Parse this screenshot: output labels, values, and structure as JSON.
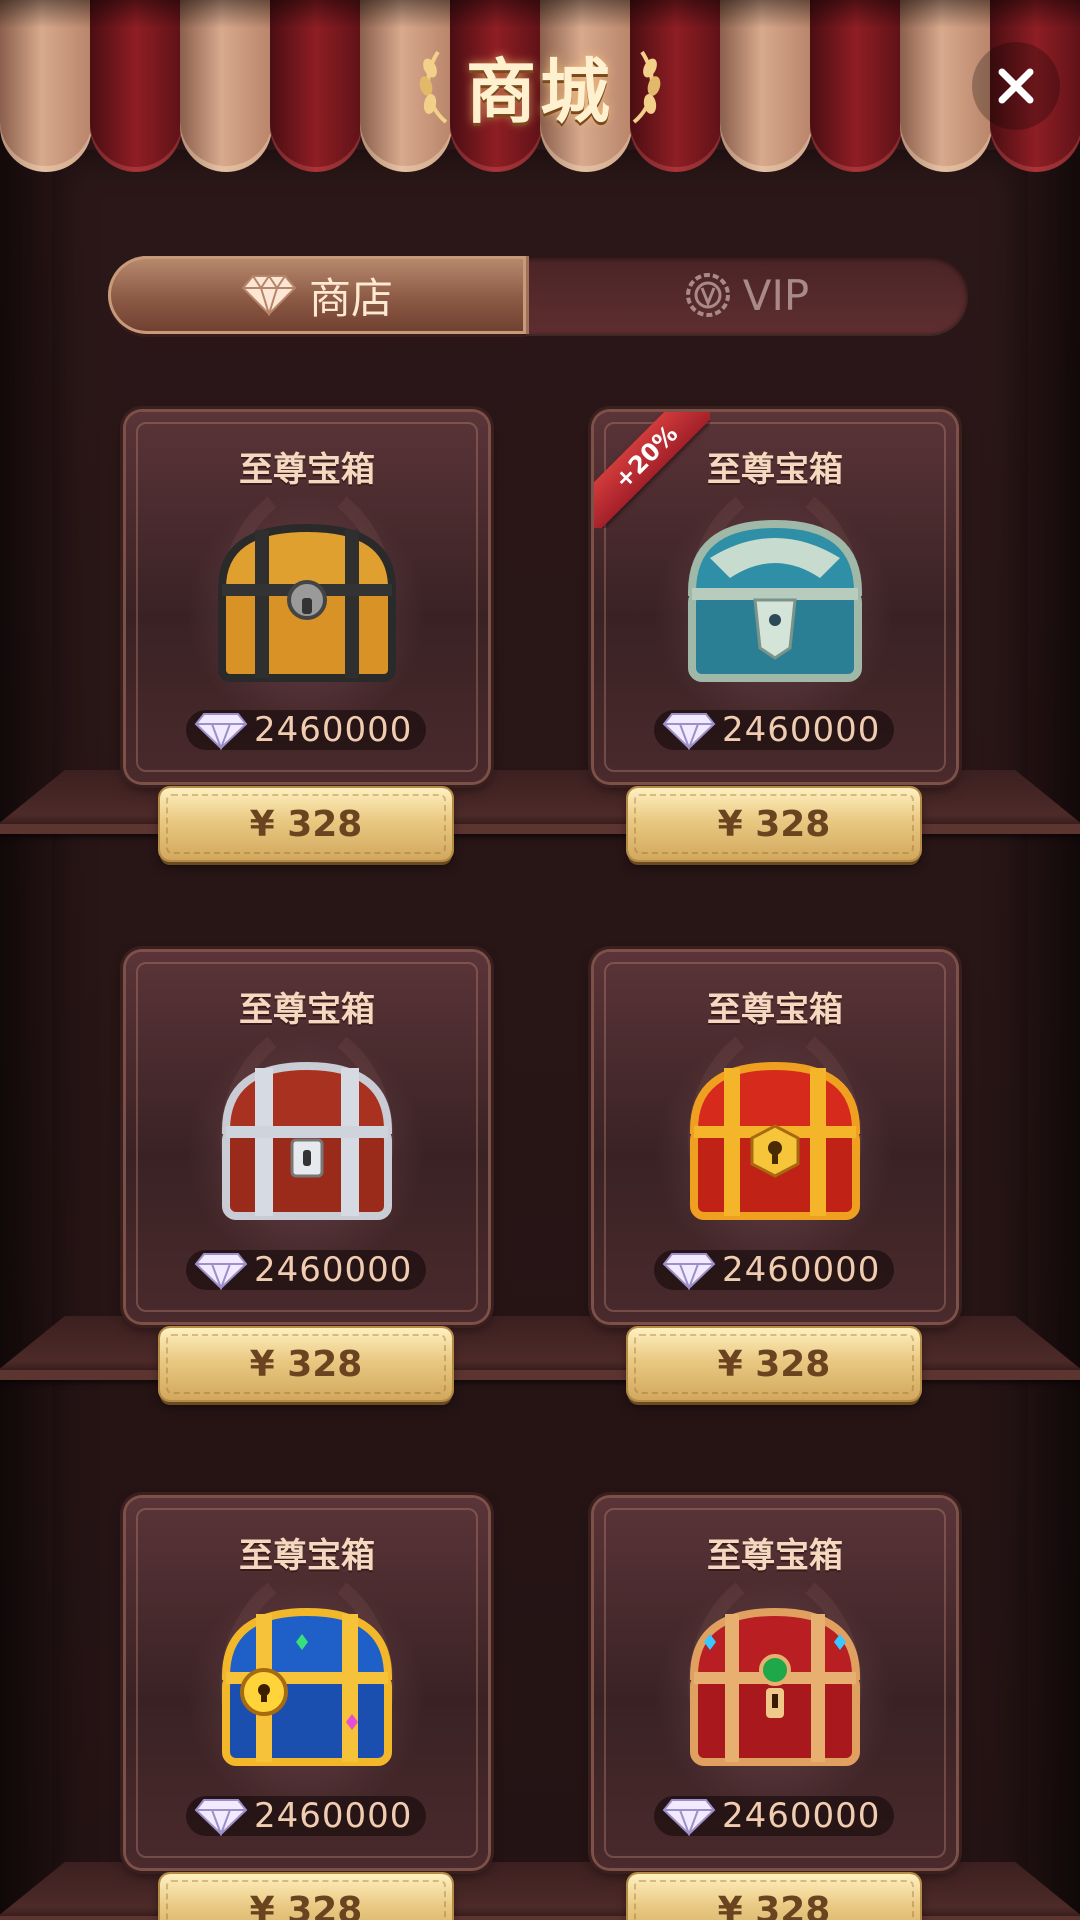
{
  "header": {
    "title": "商城",
    "close_icon": "close-icon"
  },
  "tabs": [
    {
      "label": "商店",
      "icon": "diamond-icon",
      "active": true
    },
    {
      "label": "VIP",
      "icon": "vip-badge-icon",
      "active": false
    }
  ],
  "products": [
    {
      "title": "至尊宝箱",
      "amount": "2460000",
      "price": "¥ 328",
      "chest": "wooden-gold-chest",
      "badge": ""
    },
    {
      "title": "至尊宝箱",
      "amount": "2460000",
      "price": "¥ 328",
      "chest": "teal-silver-chest",
      "badge": "+20%"
    },
    {
      "title": "至尊宝箱",
      "amount": "2460000",
      "price": "¥ 328",
      "chest": "red-silver-chest",
      "badge": ""
    },
    {
      "title": "至尊宝箱",
      "amount": "2460000",
      "price": "¥ 328",
      "chest": "red-gold-chest",
      "badge": ""
    },
    {
      "title": "至尊宝箱",
      "amount": "2460000",
      "price": "¥ 328",
      "chest": "blue-gold-jeweled-chest",
      "badge": ""
    },
    {
      "title": "至尊宝箱",
      "amount": "2460000",
      "price": "¥ 328",
      "chest": "red-jeweled-chest",
      "badge": ""
    }
  ],
  "colors": {
    "awning_light": "#d8a98d",
    "awning_dark": "#8e1e24",
    "gold_button": "#e9c982",
    "badge_red": "#c22e34"
  }
}
